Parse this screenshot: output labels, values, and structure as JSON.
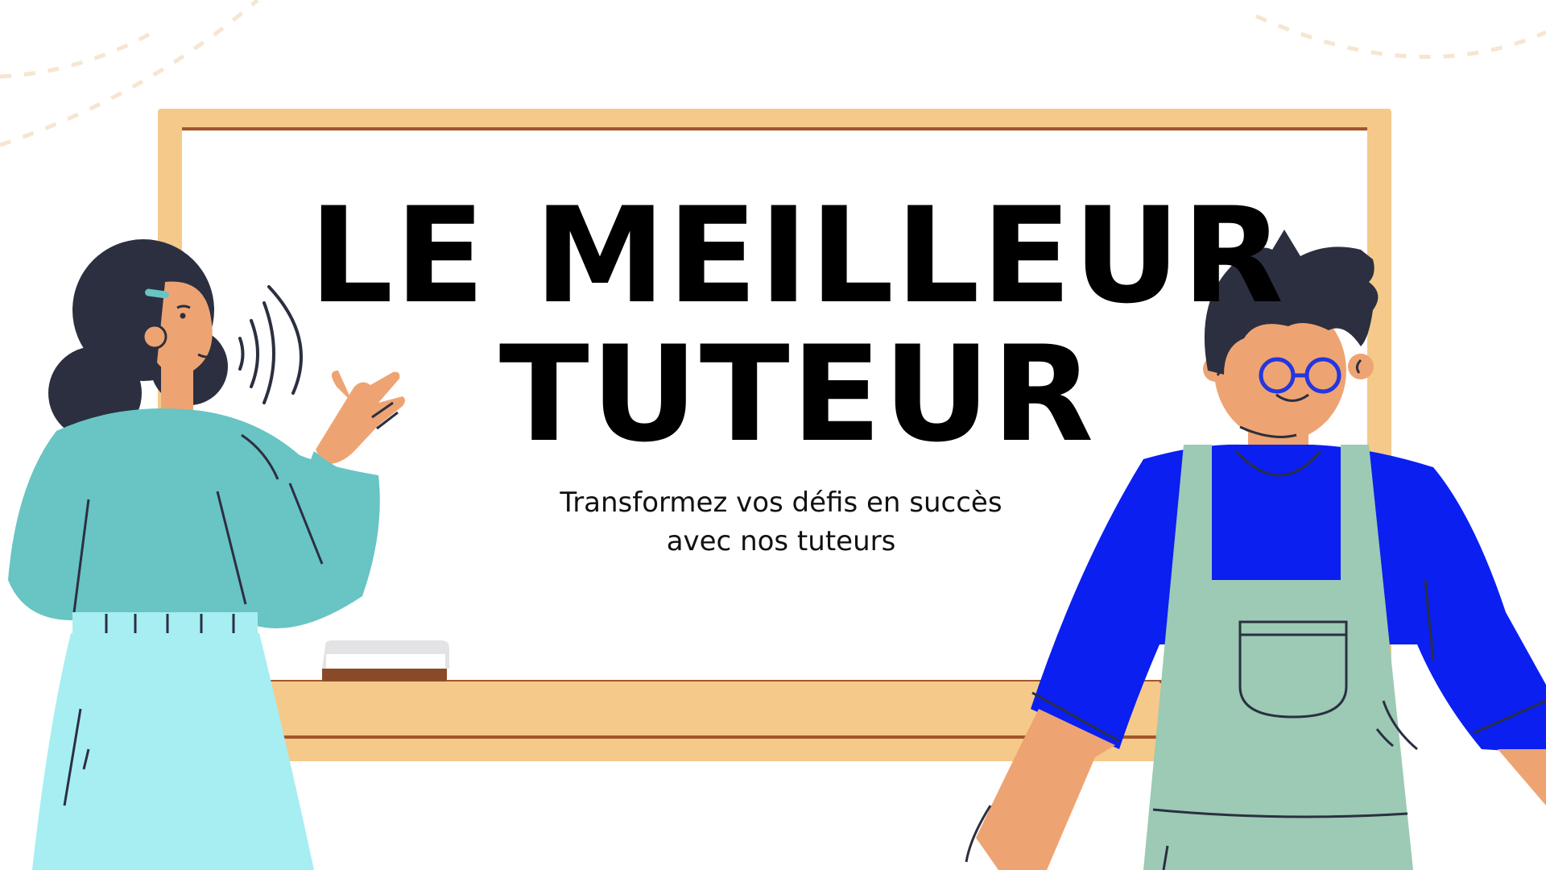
{
  "title": {
    "line1": "LE MEILLEUR",
    "line2": "TUTEUR"
  },
  "subtitle": {
    "line1": "Transformez vos défis en succès",
    "line2": "avec nos tuteurs"
  },
  "colors": {
    "background": "#ffffff",
    "board_frame": "#f5c98a",
    "board_surface": "#ffffff",
    "title_text": "#000000",
    "woman_top": "#69c4c4",
    "woman_skirt": "#a6eef2",
    "man_shirt": "#0a1ff0",
    "man_overalls": "#9ccab4",
    "skin": "#eea472",
    "hair": "#2b2f40"
  }
}
